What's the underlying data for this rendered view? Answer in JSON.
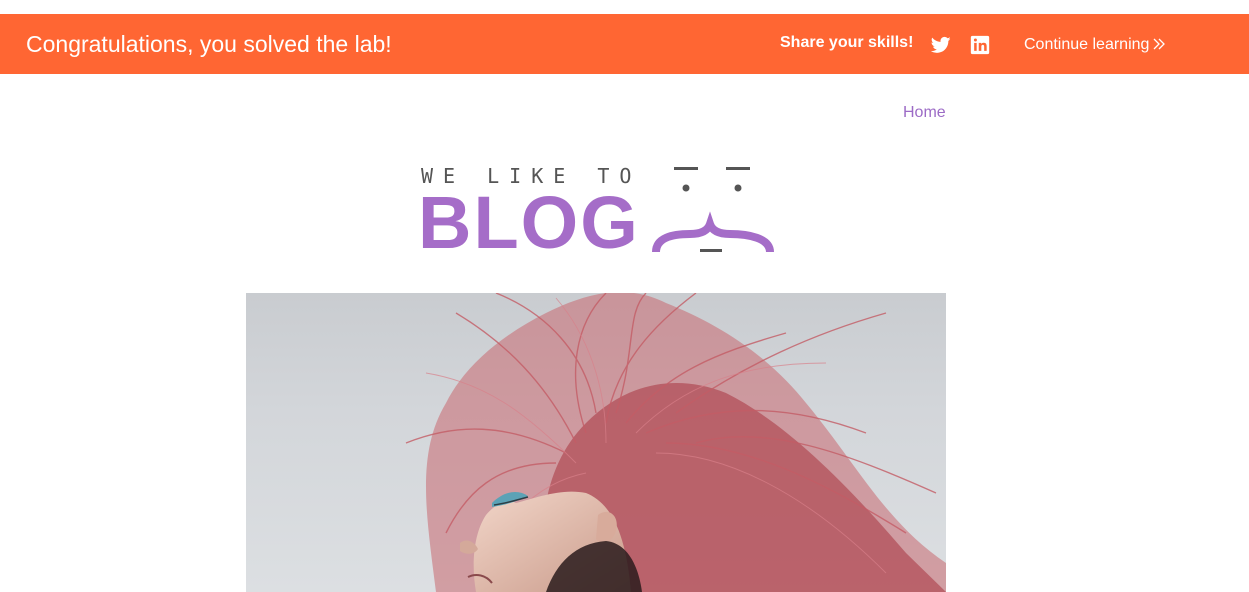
{
  "banner": {
    "title": "Congratulations, you solved the lab!",
    "share_label": "Share your skills!",
    "twitter_icon": "twitter-icon",
    "linkedin_icon": "linkedin-icon",
    "continue_label": "Continue learning",
    "continue_icon": "double-chevron-right-icon",
    "background_color": "#ff6633"
  },
  "nav": {
    "home_label": "Home",
    "link_color": "#9c6bc6"
  },
  "logo": {
    "small_text": "WE LIKE TO",
    "big_text": "BLOG",
    "face_icon": "smiley-face-logo-icon",
    "brand_color": "#a56dc8"
  },
  "hero": {
    "image_subject": "photo of a woman with flying pink hair"
  }
}
